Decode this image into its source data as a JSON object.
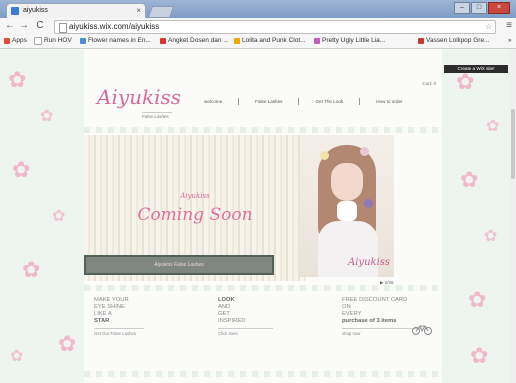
{
  "browser": {
    "tab_title": "aiyukiss",
    "tab_close": "×",
    "url": "aiyukiss.wix.com/aiyukiss",
    "back": "←",
    "forward": "→",
    "reload": "C",
    "star": "☆",
    "menu": "≡",
    "bookmarks": [
      {
        "label": "Apps",
        "color": "#e04b3a"
      },
      {
        "label": "Run HOV",
        "color": "#ffffff"
      },
      {
        "label": "Flower names in En...",
        "color": "#4a90d9"
      },
      {
        "label": "Angket Dosen dan ...",
        "color": "#d33"
      },
      {
        "label": "Lolita and Punk Clot...",
        "color": "#f0a500"
      },
      {
        "label": "Pretty Ugly Little Lia...",
        "color": "#c45db7"
      },
      {
        "label": "Vassen Lollipop Gre...",
        "color": "#c23a3a"
      }
    ],
    "more_bookmarks": "»"
  },
  "site": {
    "logo": "Aiyukiss",
    "logo_subtitle": "False Lashes",
    "cart": "Cart: 0",
    "nav": [
      "welcome",
      "False Lashes",
      "Get The Look",
      "How to order"
    ],
    "wix_badge": "Create a WiX site!",
    "hero_name": "Aiyukiss",
    "hero_coming": "Coming Soon",
    "lashes_bar": "Aiyukiss False Lashes",
    "photo_watermark": "Aiyukiss",
    "pager": "▶ 1/26",
    "col1": {
      "lines": [
        "MAKE YOUR",
        "EYE SHINE",
        "LIKE A",
        "STAR"
      ],
      "link": "Get Our False Lashes"
    },
    "col2": {
      "lines": [
        "LOOK",
        "AND",
        "GET",
        "INSPIRED"
      ],
      "link": "Click Here"
    },
    "col3": {
      "lines": [
        "FREE DISCOUNT CARD",
        "ON",
        "EVERY",
        "purchase of 3 items"
      ],
      "link": "shop now"
    }
  },
  "colors": {
    "accent_pink": "#d66b9c",
    "page_bg": "#eef5f0",
    "blossom": "#f1bfd0"
  }
}
